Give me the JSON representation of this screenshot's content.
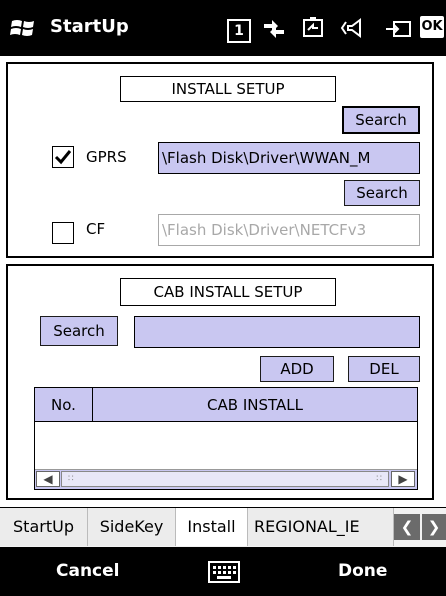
{
  "titlebar": {
    "title": "StartUp",
    "icons": [
      "windows-logo",
      "sim-1-indicator",
      "connectivity-icon",
      "battery-icon",
      "volume-icon",
      "sync-icon"
    ],
    "sim_label": "1",
    "ok_label": "OK"
  },
  "install_setup": {
    "title": "INSTALL SETUP",
    "gprs": {
      "checked": true,
      "label": "GPRS",
      "path": "\\Flash Disk\\Driver\\WWAN_M",
      "search_label": "Search"
    },
    "cf": {
      "checked": false,
      "label": "CF",
      "path": "\\Flash Disk\\Driver\\NETCFv3",
      "search_label": "Search",
      "disabled": true
    }
  },
  "cab_setup": {
    "title": "CAB INSTALL SETUP",
    "search_label": "Search",
    "path_value": "",
    "add_label": "ADD",
    "del_label": "DEL",
    "table": {
      "columns": [
        "No.",
        "CAB INSTALL"
      ],
      "rows": []
    }
  },
  "tabs": [
    {
      "label": "StartUp",
      "active": false
    },
    {
      "label": "SideKey",
      "active": false
    },
    {
      "label": "Install",
      "active": true
    },
    {
      "label": "REGIONAL_IE",
      "active": false
    }
  ],
  "softkeys": {
    "left": "Cancel",
    "right": "Done"
  },
  "colors": {
    "accent": "#c9c7f1",
    "bar": "#000000"
  }
}
